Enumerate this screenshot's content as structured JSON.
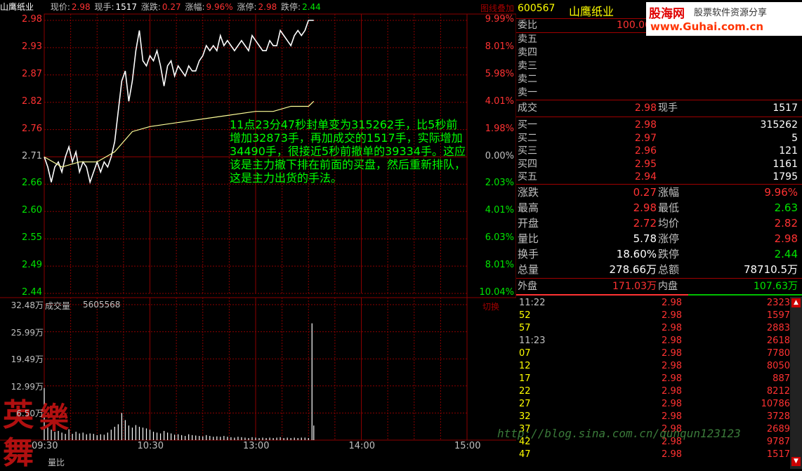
{
  "top_bar": {
    "stock_short_name": "山鹰纸业",
    "price_label": "现价:",
    "price": "2.98",
    "volume_label": "现手:",
    "volume": "1517",
    "change_label": "涨跌:",
    "change": "0.27",
    "change_pct_label": "涨幅:",
    "change_pct": "9.96%",
    "limit_up_label": "涨停:",
    "limit_up": "2.98",
    "limit_down_label": "跌停:",
    "limit_down": "2.44",
    "overlay_button": "图线叠加"
  },
  "price_axis": {
    "left_labels": [
      "2.98",
      "2.93",
      "2.87",
      "2.82",
      "2.76",
      "2.71",
      "2.66",
      "2.60",
      "2.55",
      "2.49",
      "2.44"
    ],
    "right_labels": [
      "9.99%",
      "8.01%",
      "5.98%",
      "4.01%",
      "1.98%",
      "0.00%",
      "2.03%",
      "4.01%",
      "6.03%",
      "8.01%",
      "10.04%"
    ]
  },
  "volume_axis": {
    "labels": [
      "32.48万",
      "25.99万",
      "19.49万",
      "12.99万",
      "6.50万"
    ],
    "title": "成交量",
    "total": "5605568",
    "switch_button": "切换"
  },
  "time_axis": [
    "09:30",
    "10:30",
    "13:00",
    "14:00",
    "15:00"
  ],
  "bottom_tab": "量比",
  "annotation": "11点23分47秒封单变为315262手，比5秒前增加32873手，再加成交的1517手，实际增加34490手，很接近5秒前撤单的39334手。这应该是主力撤下排在前面的买盘，然后重新排队，这是主力出货的手法。",
  "panel": {
    "code": "600567",
    "name": "山鹰纸业",
    "weibi_label": "委比",
    "weibi_value": "100.00",
    "sell_labels": [
      "卖五",
      "卖四",
      "卖三",
      "卖二",
      "卖一"
    ],
    "deal_label": "成交",
    "deal_value": "2.98",
    "now_label": "现手",
    "now_value": "1517",
    "buy": [
      {
        "label": "买一",
        "price": "2.98",
        "vol": "315262"
      },
      {
        "label": "买二",
        "price": "2.97",
        "vol": "5"
      },
      {
        "label": "买三",
        "price": "2.96",
        "vol": "121"
      },
      {
        "label": "买四",
        "price": "2.95",
        "vol": "1161"
      },
      {
        "label": "买五",
        "price": "2.94",
        "vol": "1795"
      }
    ],
    "stats": [
      {
        "l1": "涨跌",
        "v1": "0.27",
        "l2": "涨幅",
        "v2": "9.96%"
      },
      {
        "l1": "最高",
        "v1": "2.98",
        "l2": "最低",
        "v2": "2.63"
      },
      {
        "l1": "开盘",
        "v1": "2.72",
        "l2": "均价",
        "v2": "2.82"
      },
      {
        "l1": "量比",
        "v1": "5.78",
        "l2": "涨停",
        "v2": "2.98"
      },
      {
        "l1": "换手",
        "v1": "18.60%",
        "l2": "跌停",
        "v2": "2.44"
      },
      {
        "l1": "总量",
        "v1": "278.66万",
        "l2": "总额",
        "v2": "78710.5万"
      }
    ],
    "outer_label": "外盘",
    "outer_value": "171.03万",
    "inner_label": "内盘",
    "inner_value": "107.63万",
    "ticks": [
      {
        "time": "11:22",
        "price": "2.98",
        "vol": "2323"
      },
      {
        "time": "52",
        "price": "2.98",
        "vol": "1597"
      },
      {
        "time": "57",
        "price": "2.98",
        "vol": "2883"
      },
      {
        "time": "11:23",
        "price": "2.98",
        "vol": "2618"
      },
      {
        "time": "07",
        "price": "2.98",
        "vol": "7780"
      },
      {
        "time": "12",
        "price": "2.98",
        "vol": "8050"
      },
      {
        "time": "17",
        "price": "2.98",
        "vol": "887"
      },
      {
        "time": "22",
        "price": "2.98",
        "vol": "8212"
      },
      {
        "time": "27",
        "price": "2.98",
        "vol": "10786"
      },
      {
        "time": "32",
        "price": "2.98",
        "vol": "3728"
      },
      {
        "time": "37",
        "price": "2.98",
        "vol": "2689"
      },
      {
        "time": "42",
        "price": "2.98",
        "vol": "9787"
      },
      {
        "time": "47",
        "price": "2.98",
        "vol": "1517"
      }
    ]
  },
  "logo": {
    "brand": "股海网",
    "slogan": "股票软件资源分享",
    "url": "www.Guhai.com.cn"
  },
  "watermark": "http://blog.sina.com.cn/qunqun123123",
  "stamp_text": [
    "英",
    "舞",
    "樂"
  ],
  "colors": {
    "grid": "#8b0000",
    "price_line": "#ffffff",
    "avg_line": "#ffff99",
    "up": "#ff3232",
    "down": "#00e600"
  },
  "chart_data": {
    "type": "line",
    "title": "",
    "x_ticks": [
      "09:30",
      "10:30",
      "13:00",
      "14:00",
      "15:00"
    ],
    "ylim": [
      2.44,
      2.98
    ],
    "price_series": {
      "x_minutes": [
        0,
        2,
        4,
        6,
        8,
        10,
        12,
        14,
        16,
        18,
        20,
        22,
        24,
        26,
        28,
        30,
        32,
        34,
        36,
        38,
        40,
        42,
        44,
        46,
        48,
        50,
        52,
        54,
        56,
        58,
        60,
        62,
        64,
        66,
        68,
        70,
        72,
        74,
        76,
        78,
        80,
        82,
        84,
        86,
        88,
        90,
        92,
        94,
        96,
        98,
        100,
        102,
        104,
        106,
        108,
        110,
        112,
        114,
        116,
        118,
        120,
        122,
        124,
        126,
        128,
        130,
        132,
        134,
        136,
        138,
        140,
        142,
        144,
        146,
        148,
        150,
        152,
        153
      ],
      "values": [
        2.71,
        2.69,
        2.66,
        2.69,
        2.7,
        2.68,
        2.71,
        2.73,
        2.7,
        2.72,
        2.68,
        2.7,
        2.69,
        2.66,
        2.68,
        2.7,
        2.68,
        2.7,
        2.69,
        2.71,
        2.74,
        2.8,
        2.86,
        2.88,
        2.82,
        2.86,
        2.92,
        2.96,
        2.9,
        2.89,
        2.91,
        2.9,
        2.92,
        2.89,
        2.85,
        2.89,
        2.9,
        2.87,
        2.89,
        2.88,
        2.87,
        2.89,
        2.88,
        2.88,
        2.9,
        2.91,
        2.93,
        2.92,
        2.93,
        2.92,
        2.95,
        2.93,
        2.94,
        2.93,
        2.92,
        2.93,
        2.94,
        2.93,
        2.92,
        2.95,
        2.94,
        2.93,
        2.92,
        2.92,
        2.94,
        2.93,
        2.93,
        2.96,
        2.95,
        2.94,
        2.93,
        2.95,
        2.96,
        2.95,
        2.96,
        2.98,
        2.98,
        2.98
      ],
      "color": "#ffffff"
    },
    "avg_series": {
      "x_minutes": [
        0,
        10,
        20,
        30,
        35,
        40,
        45,
        50,
        60,
        80,
        100,
        120,
        130,
        140,
        150,
        153
      ],
      "values": [
        2.71,
        2.69,
        2.7,
        2.7,
        2.71,
        2.72,
        2.74,
        2.76,
        2.77,
        2.78,
        2.79,
        2.8,
        2.8,
        2.81,
        2.81,
        2.82
      ],
      "color": "#ffff99"
    },
    "volume_series": {
      "ylim": [
        0,
        32.48
      ],
      "unit": "万",
      "x_minutes": [
        0,
        2,
        4,
        6,
        8,
        10,
        12,
        14,
        16,
        18,
        20,
        22,
        24,
        26,
        28,
        30,
        32,
        34,
        36,
        38,
        40,
        42,
        44,
        46,
        48,
        50,
        52,
        54,
        56,
        58,
        60,
        62,
        64,
        66,
        68,
        70,
        72,
        74,
        76,
        78,
        80,
        82,
        84,
        86,
        88,
        90,
        92,
        94,
        96,
        98,
        100,
        102,
        104,
        106,
        108,
        110,
        112,
        114,
        116,
        118,
        120,
        122,
        124,
        126,
        128,
        130,
        132,
        134,
        136,
        138,
        140,
        142,
        144,
        146,
        148,
        150,
        152,
        153
      ],
      "values": [
        12.5,
        3.0,
        2.5,
        2.0,
        2.2,
        1.8,
        1.5,
        2.6,
        1.5,
        2.0,
        1.6,
        1.8,
        1.4,
        1.6,
        1.5,
        1.2,
        1.4,
        1.3,
        1.8,
        2.5,
        3.2,
        3.8,
        6.5,
        4.8,
        3.5,
        3.0,
        3.6,
        3.2,
        3.0,
        2.8,
        2.5,
        2.0,
        1.8,
        1.6,
        2.2,
        1.8,
        1.6,
        1.3,
        1.4,
        1.2,
        1.0,
        1.4,
        1.2,
        1.1,
        1.0,
        0.9,
        1.2,
        1.0,
        0.8,
        0.9,
        0.8,
        1.0,
        0.8,
        0.7,
        0.6,
        0.8,
        0.7,
        0.6,
        0.5,
        0.7,
        0.6,
        0.5,
        0.6,
        0.5,
        0.6,
        0.5,
        0.6,
        0.7,
        0.5,
        0.6,
        0.5,
        0.6,
        0.5,
        0.6,
        0.6,
        0.5,
        28.0,
        3.5
      ],
      "color": "#ffffff"
    }
  }
}
